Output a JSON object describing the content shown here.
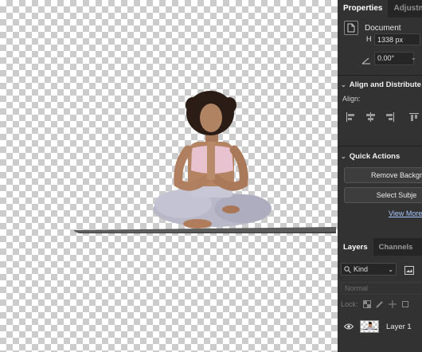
{
  "canvas": {
    "subject": "yoga-figure"
  },
  "properties_panel": {
    "tabs": [
      {
        "label": "Properties",
        "active": true
      },
      {
        "label": "Adjustme",
        "active": false
      }
    ],
    "document_label": "Document",
    "height_field": {
      "prefix": "H",
      "value": "1338 px"
    },
    "angle_value": "0.00°",
    "align_section": {
      "title": "Align and Distribute",
      "align_label": "Align:"
    },
    "quick_actions": {
      "title": "Quick Actions",
      "remove_background": "Remove Backgr",
      "select_subject": "Select Subje",
      "view_more": "View More"
    }
  },
  "layers_panel": {
    "tabs": [
      {
        "label": "Layers",
        "active": true
      },
      {
        "label": "Channels",
        "active": false
      }
    ],
    "filter_kind": "Kind",
    "blend_mode": "Normal",
    "lock_label": "Lock:",
    "layers": [
      {
        "name": "Layer 1",
        "visible": true
      }
    ]
  },
  "colors": {
    "panel_bg": "#323232",
    "tab_bar_bg": "#252525",
    "link": "#a8c7ff"
  }
}
